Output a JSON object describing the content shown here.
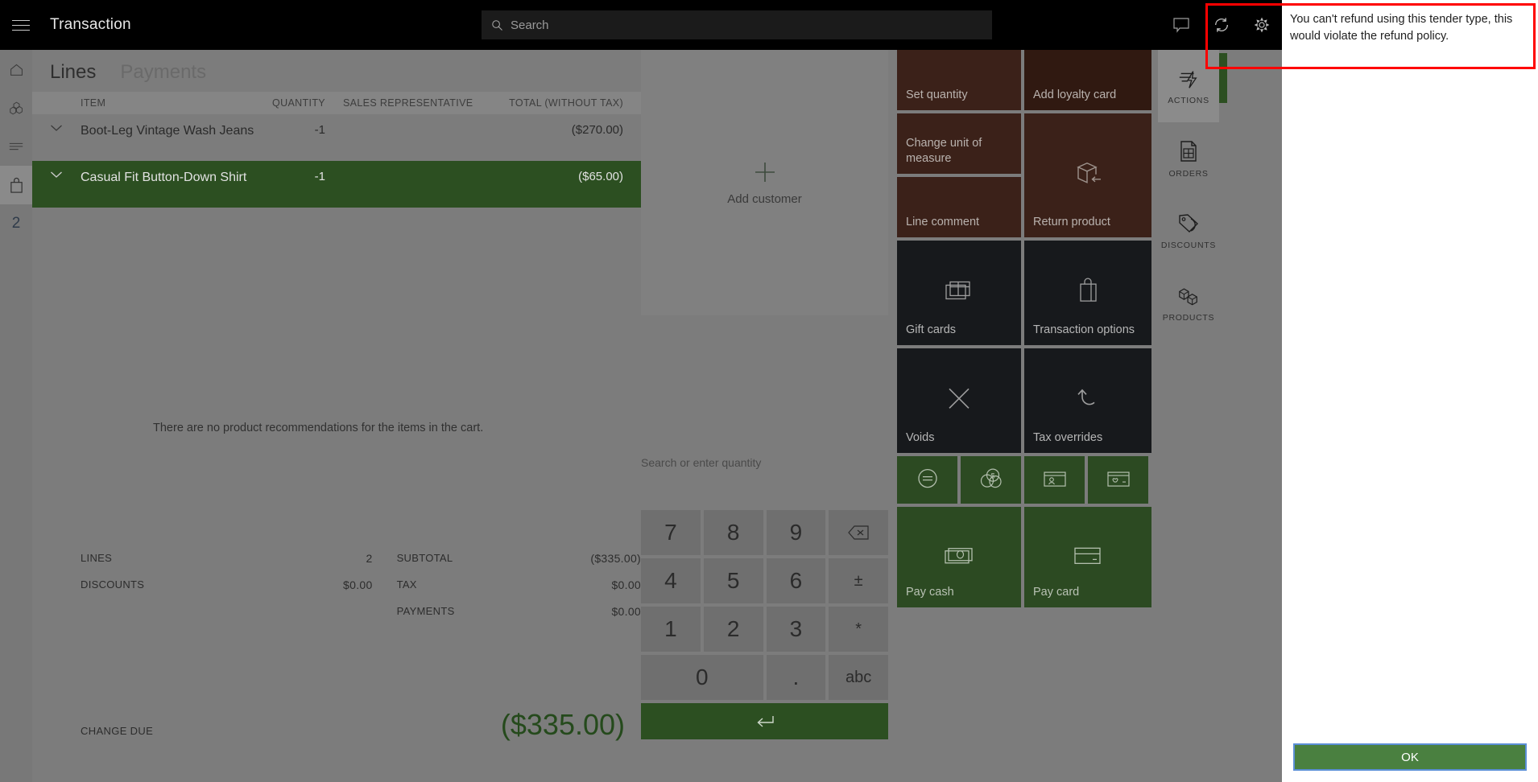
{
  "topbar": {
    "menu_icon": "hamburger-icon",
    "title": "Transaction",
    "search_placeholder": "Search",
    "search_icon": "search-icon",
    "icons": [
      "notification-icon",
      "refresh-icon",
      "settings-gear-icon"
    ]
  },
  "left_rail": {
    "items": [
      {
        "icon": "home-icon",
        "selected": false
      },
      {
        "icon": "products-boxes-icon",
        "selected": false
      },
      {
        "icon": "lines-list-icon",
        "selected": false
      },
      {
        "icon": "shopping-bag-icon",
        "selected": true
      }
    ],
    "badge_count": "2"
  },
  "cart": {
    "tabs": [
      {
        "label": "Lines",
        "active": true
      },
      {
        "label": "Payments",
        "active": false
      }
    ],
    "columns": {
      "item": "ITEM",
      "quantity": "QUANTITY",
      "sales_representative": "SALES REPRESENTATIVE",
      "total": "TOTAL (WITHOUT TAX)"
    },
    "lines": [
      {
        "name": "Boot-Leg Vintage Wash Jeans",
        "quantity": "-1",
        "sales_representative": "",
        "total": "($270.00)",
        "selected": false
      },
      {
        "name": "Casual Fit Button-Down Shirt",
        "quantity": "-1",
        "sales_representative": "",
        "total": "($65.00)",
        "selected": true
      }
    ],
    "recommendation_text": "There are no product recommendations for the items in the cart.",
    "totals": {
      "lines_label": "LINES",
      "lines_value": "2",
      "discounts_label": "DISCOUNTS",
      "discounts_value": "$0.00",
      "subtotal_label": "SUBTOTAL",
      "subtotal_value": "($335.00)",
      "tax_label": "TAX",
      "tax_value": "$0.00",
      "payments_label": "PAYMENTS",
      "payments_value": "$0.00",
      "change_due_label": "CHANGE DUE",
      "change_due_value": "($335.00)"
    }
  },
  "customer_panel": {
    "add_customer_label": "Add customer",
    "plus_icon": "plus-icon"
  },
  "keypad": {
    "quantity_hint": "Search or enter quantity",
    "keys": [
      {
        "label": "7",
        "name": "key-7"
      },
      {
        "label": "8",
        "name": "key-8"
      },
      {
        "label": "9",
        "name": "key-9"
      },
      {
        "label": "",
        "name": "backspace-icon"
      },
      {
        "label": "4",
        "name": "key-4"
      },
      {
        "label": "5",
        "name": "key-5"
      },
      {
        "label": "6",
        "name": "key-6"
      },
      {
        "label": "±",
        "name": "key-plus-minus"
      },
      {
        "label": "1",
        "name": "key-1"
      },
      {
        "label": "2",
        "name": "key-2"
      },
      {
        "label": "3",
        "name": "key-3"
      },
      {
        "label": "*",
        "name": "key-asterisk"
      },
      {
        "label": "0",
        "name": "key-0"
      },
      {
        "label": ".",
        "name": "key-decimal"
      },
      {
        "label": "abc",
        "name": "key-abc"
      }
    ],
    "enter_icon": "enter-arrow-icon"
  },
  "tiles": [
    {
      "label": "Set quantity",
      "style": "brown",
      "icon": ""
    },
    {
      "label": "Add loyalty card",
      "style": "brown",
      "icon": ""
    },
    {
      "label": "Change unit of measure",
      "style": "brown",
      "icon": ""
    },
    {
      "label": "Return product",
      "style": "brown",
      "icon": "return-product-icon"
    },
    {
      "label": "Line comment",
      "style": "brown",
      "icon": ""
    },
    {
      "label": "Gift cards",
      "style": "dark",
      "icon": "gift-card-icon"
    },
    {
      "label": "Transaction options",
      "style": "dark",
      "icon": "shopping-bag-icon"
    },
    {
      "label": "Voids",
      "style": "dark",
      "icon": "close-x-icon"
    },
    {
      "label": "Tax overrides",
      "style": "dark",
      "icon": "undo-arrow-icon"
    },
    {
      "label": "",
      "style": "green",
      "icon": "exact-amount-icon"
    },
    {
      "label": "",
      "style": "green",
      "icon": "currency-exchange-icon"
    },
    {
      "label": "",
      "style": "green",
      "icon": "customer-card-icon"
    },
    {
      "label": "",
      "style": "green",
      "icon": "loyalty-card-icon"
    },
    {
      "label": "Pay cash",
      "style": "green",
      "icon": "cash-bills-icon"
    },
    {
      "label": "Pay card",
      "style": "green",
      "icon": "credit-card-icon"
    }
  ],
  "right_rail": [
    {
      "label": "ACTIONS",
      "icon": "actions-lightning-icon",
      "selected": true
    },
    {
      "label": "ORDERS",
      "icon": "orders-document-icon",
      "selected": false
    },
    {
      "label": "DISCOUNTS",
      "icon": "discount-tag-icon",
      "selected": false
    },
    {
      "label": "PRODUCTS",
      "icon": "products-boxes-icon",
      "selected": false
    }
  ],
  "dialog": {
    "message": "You can't refund using this tender type, this would violate the refund policy.",
    "ok_label": "OK"
  },
  "colors": {
    "accent_green": "#2c4f21",
    "tile_brown": "#3b2119",
    "tile_dark": "#17191c",
    "tile_green": "#2c4a22",
    "highlight_red": "#ff0000",
    "topbar_black": "#000000",
    "dim_overlay": "#7c7c7c"
  }
}
